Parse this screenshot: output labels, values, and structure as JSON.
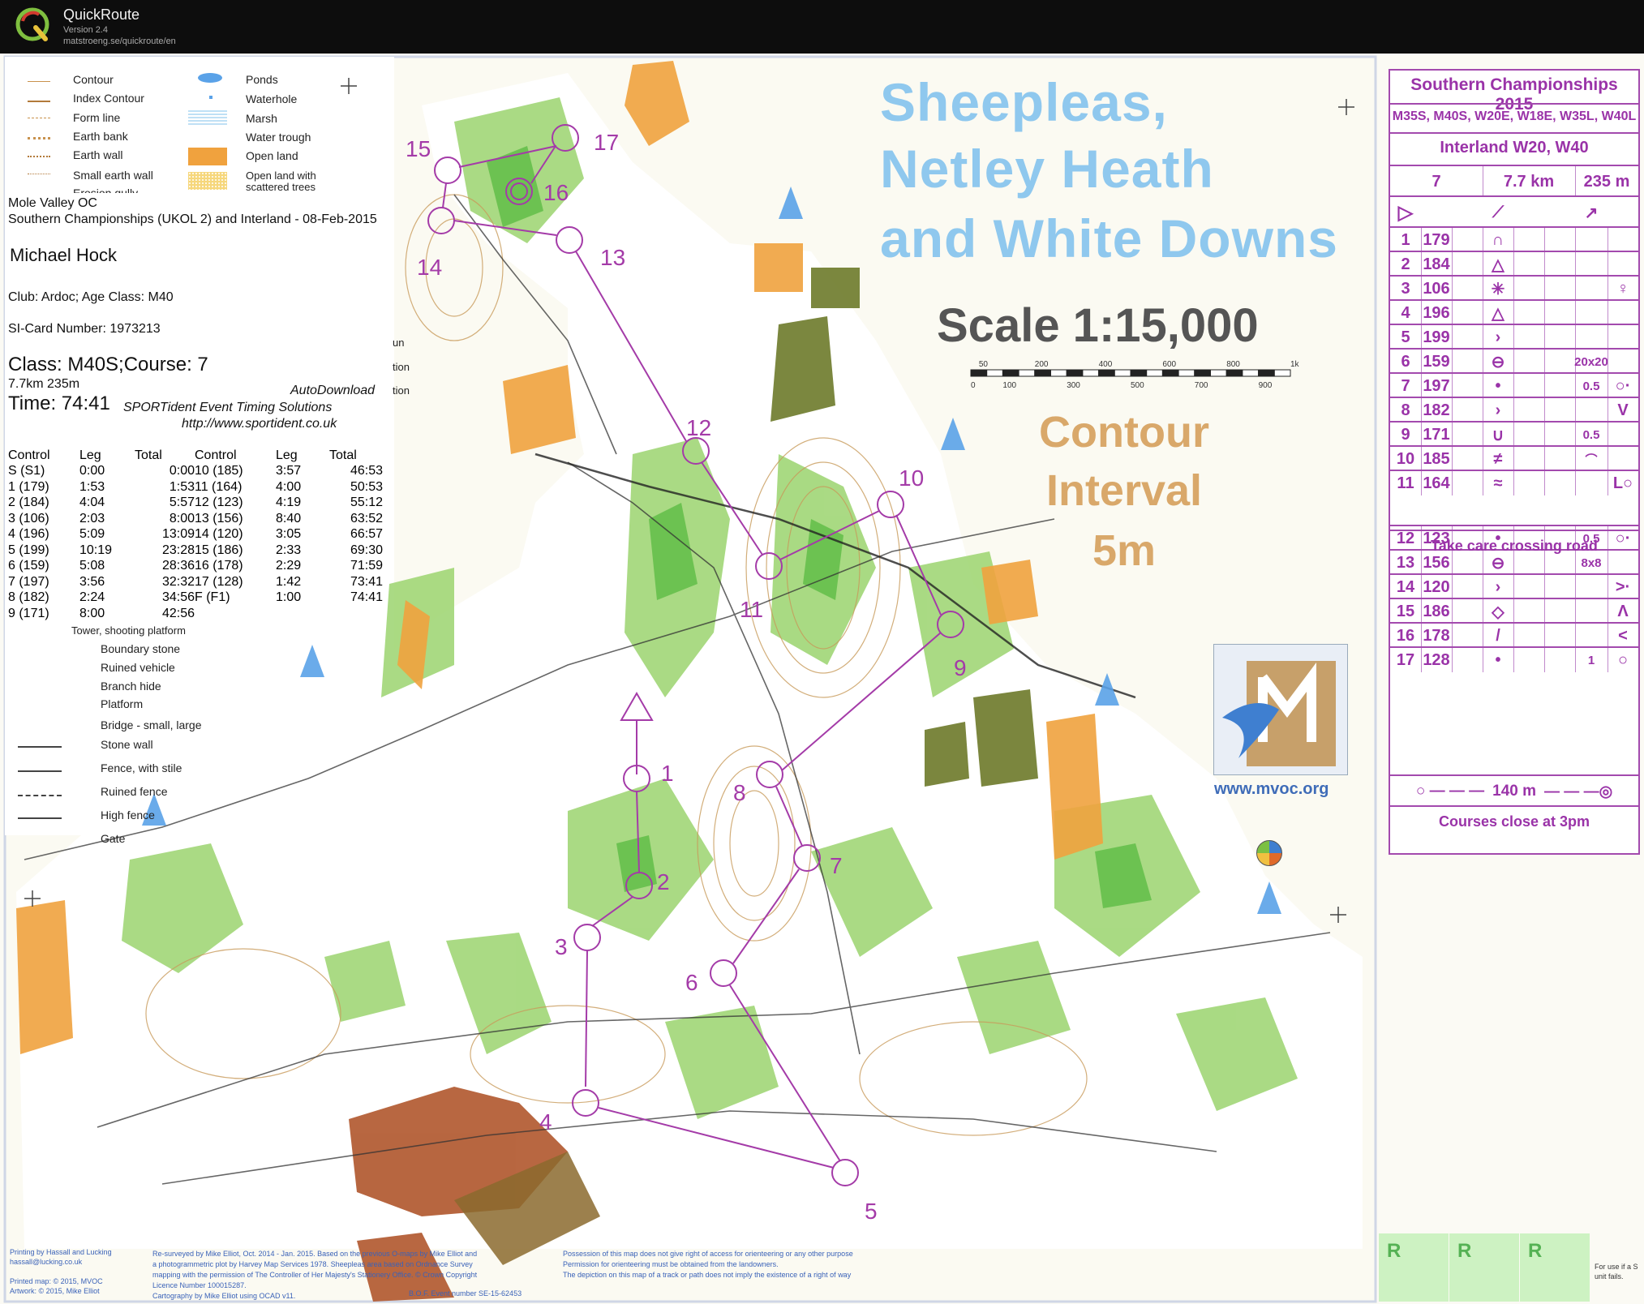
{
  "app": {
    "name": "QuickRoute",
    "version": "Version 2.4",
    "url": "matstroeng.se/quickroute/en"
  },
  "legend": {
    "items_left": [
      "Contour",
      "Index Contour",
      "Form line",
      "Earth bank",
      "Earth wall",
      "Small earth wall",
      "Erosion gully"
    ],
    "items_right": [
      "Ponds",
      "Waterhole",
      "Marsh",
      "Water trough",
      "Open land",
      "Open land with scattered trees"
    ],
    "items_lower": [
      "Tower, shooting platform",
      "Boundary stone",
      "Ruined vehicle",
      "Branch hide",
      "Platform",
      "Bridge - small, large",
      "Stone wall",
      "Fence, with stile",
      "Ruined fence",
      "High fence",
      "Gate"
    ],
    "partial_words": [
      "un",
      "tion",
      "tion"
    ]
  },
  "runner": {
    "organiser": "Mole Valley OC",
    "event": "Southern Championships (UKOL 2) and Interland - 08-Feb-2015",
    "name": "Michael  Hock",
    "club": "Club: Ardoc; Age Class: M40",
    "sicard": "SI-Card  Number:  1973213",
    "class_course": "Class: M40S;Course: 7",
    "length_climb": "7.7km 235m",
    "time": "Time: 74:41",
    "autodownload": "AutoDownload",
    "sportident": "SPORTident Event Timing Solutions",
    "sportident_url": "http://www.sportident.co.uk"
  },
  "splits": {
    "headers": [
      "Control",
      "Leg",
      "Total",
      "Control",
      "Leg",
      "Total"
    ],
    "rows": [
      [
        "S (S1)",
        "0:00",
        "0:00",
        "10 (185)",
        "3:57",
        "46:53"
      ],
      [
        "1 (179)",
        "1:53",
        "1:53",
        "11 (164)",
        "4:00",
        "50:53"
      ],
      [
        "2 (184)",
        "4:04",
        "5:57",
        "12 (123)",
        "4:19",
        "55:12"
      ],
      [
        "3 (106)",
        "2:03",
        "8:00",
        "13 (156)",
        "8:40",
        "63:52"
      ],
      [
        "4 (196)",
        "5:09",
        "13:09",
        "14 (120)",
        "3:05",
        "66:57"
      ],
      [
        "5 (199)",
        "10:19",
        "23:28",
        "15 (186)",
        "2:33",
        "69:30"
      ],
      [
        "6 (159)",
        "5:08",
        "28:36",
        "16 (178)",
        "2:29",
        "71:59"
      ],
      [
        "7 (197)",
        "3:56",
        "32:32",
        "17 (128)",
        "1:42",
        "73:41"
      ],
      [
        "8 (182)",
        "2:24",
        "34:56",
        "F (F1)",
        "1:00",
        "74:41"
      ],
      [
        "9 (171)",
        "8:00",
        "42:56",
        "",
        "",
        ""
      ]
    ]
  },
  "map_title": [
    "Sheepleas,",
    "Netley Heath",
    "and White Downs"
  ],
  "scale": {
    "text": "Scale 1:15,000",
    "ticks_top": [
      "50",
      "200",
      "400",
      "600",
      "800",
      "1k"
    ],
    "ticks_bottom": [
      "0",
      "100",
      "300",
      "500",
      "700",
      "900"
    ]
  },
  "contour": [
    "Contour",
    "Interval",
    "5m"
  ],
  "description": {
    "event": "Southern Championships 2015",
    "classes": "M35S, M40S, W20E, W18E, W35L, W40L",
    "interland": "Interland W20, W40",
    "course": "7",
    "length": "7.7 km",
    "climb": "235 m",
    "rows": [
      {
        "n": "1",
        "code": "179",
        "sym": "∩",
        "dim": "",
        "extra": ""
      },
      {
        "n": "2",
        "code": "184",
        "sym": "△",
        "dim": "",
        "extra": ""
      },
      {
        "n": "3",
        "code": "106",
        "sym": "✳",
        "dim": "",
        "extra": "♀"
      },
      {
        "n": "4",
        "code": "196",
        "sym": "△",
        "dim": "",
        "extra": ""
      },
      {
        "n": "5",
        "code": "199",
        "sym": "›",
        "dim": "",
        "extra": ""
      },
      {
        "n": "6",
        "code": "159",
        "sym": "⊖",
        "dim": "20x20",
        "extra": ""
      },
      {
        "n": "7",
        "code": "197",
        "sym": "•",
        "dim": "0.5",
        "extra": "○·"
      },
      {
        "n": "8",
        "code": "182",
        "sym": "›",
        "dim": "",
        "extra": "V"
      },
      {
        "n": "9",
        "code": "171",
        "sym": "∪",
        "dim": "0.5",
        "extra": ""
      },
      {
        "n": "10",
        "code": "185",
        "sym": "≠",
        "dim": "⌒",
        "extra": ""
      },
      {
        "n": "11",
        "code": "164",
        "sym": "≈",
        "dim": "",
        "extra": "L○"
      },
      {
        "n": "12",
        "code": "123",
        "sym": "•",
        "dim": "0.5",
        "extra": "○·"
      },
      {
        "n": "13",
        "code": "156",
        "sym": "⊖",
        "dim": "8x8",
        "extra": ""
      },
      {
        "n": "14",
        "code": "120",
        "sym": "›",
        "dim": "",
        "extra": ">·"
      },
      {
        "n": "15",
        "code": "186",
        "sym": "◇",
        "dim": "",
        "extra": "Λ"
      },
      {
        "n": "16",
        "code": "178",
        "sym": "/",
        "dim": "",
        "extra": "<"
      },
      {
        "n": "17",
        "code": "128",
        "sym": "•",
        "dim": "1",
        "extra": "○"
      }
    ],
    "road_note": "Take care crossing road",
    "finish": "140 m",
    "close_note": "Courses close at 3pm"
  },
  "course_controls": [
    "1",
    "2",
    "3",
    "4",
    "5",
    "6",
    "7",
    "8",
    "9",
    "10",
    "11",
    "12",
    "13",
    "14",
    "15",
    "16",
    "17"
  ],
  "mvoc_url": "www.mvoc.org",
  "footer": {
    "printing": [
      "Printing by Hassall and Lucking",
      "hassall@lucking.co.uk",
      "",
      "Printed map: © 2015, MVOC",
      "Artwork: © 2015, Mike Elliot"
    ],
    "survey": [
      "Re-surveyed by Mike Elliot, Oct. 2014 - Jan. 2015. Based on the previous O-maps by Mike Elliot and",
      "a photogrammetric plot by Harvey Map Services 1978. Sheepleas area based on Ordnance Survey",
      "mapping with the permission of The Controller of Her Majesty's Stationery Office. © Crown Copyright",
      "Licence Number 100015287.",
      "Cartography by Mike Elliot using OCAD v11."
    ],
    "bof": "B.O.F. Event number SE-15-62453",
    "access": [
      "Possession of this map does not give right of access for orienteering or any other purpose",
      "Permission for orienteering must be obtained from the landowners.",
      "The depiction on this map of a track or path does not imply the existence of a right of way"
    ],
    "r_labels": [
      "R",
      "R",
      "R"
    ],
    "unit_note": [
      "For use if a S",
      "unit fails."
    ]
  }
}
